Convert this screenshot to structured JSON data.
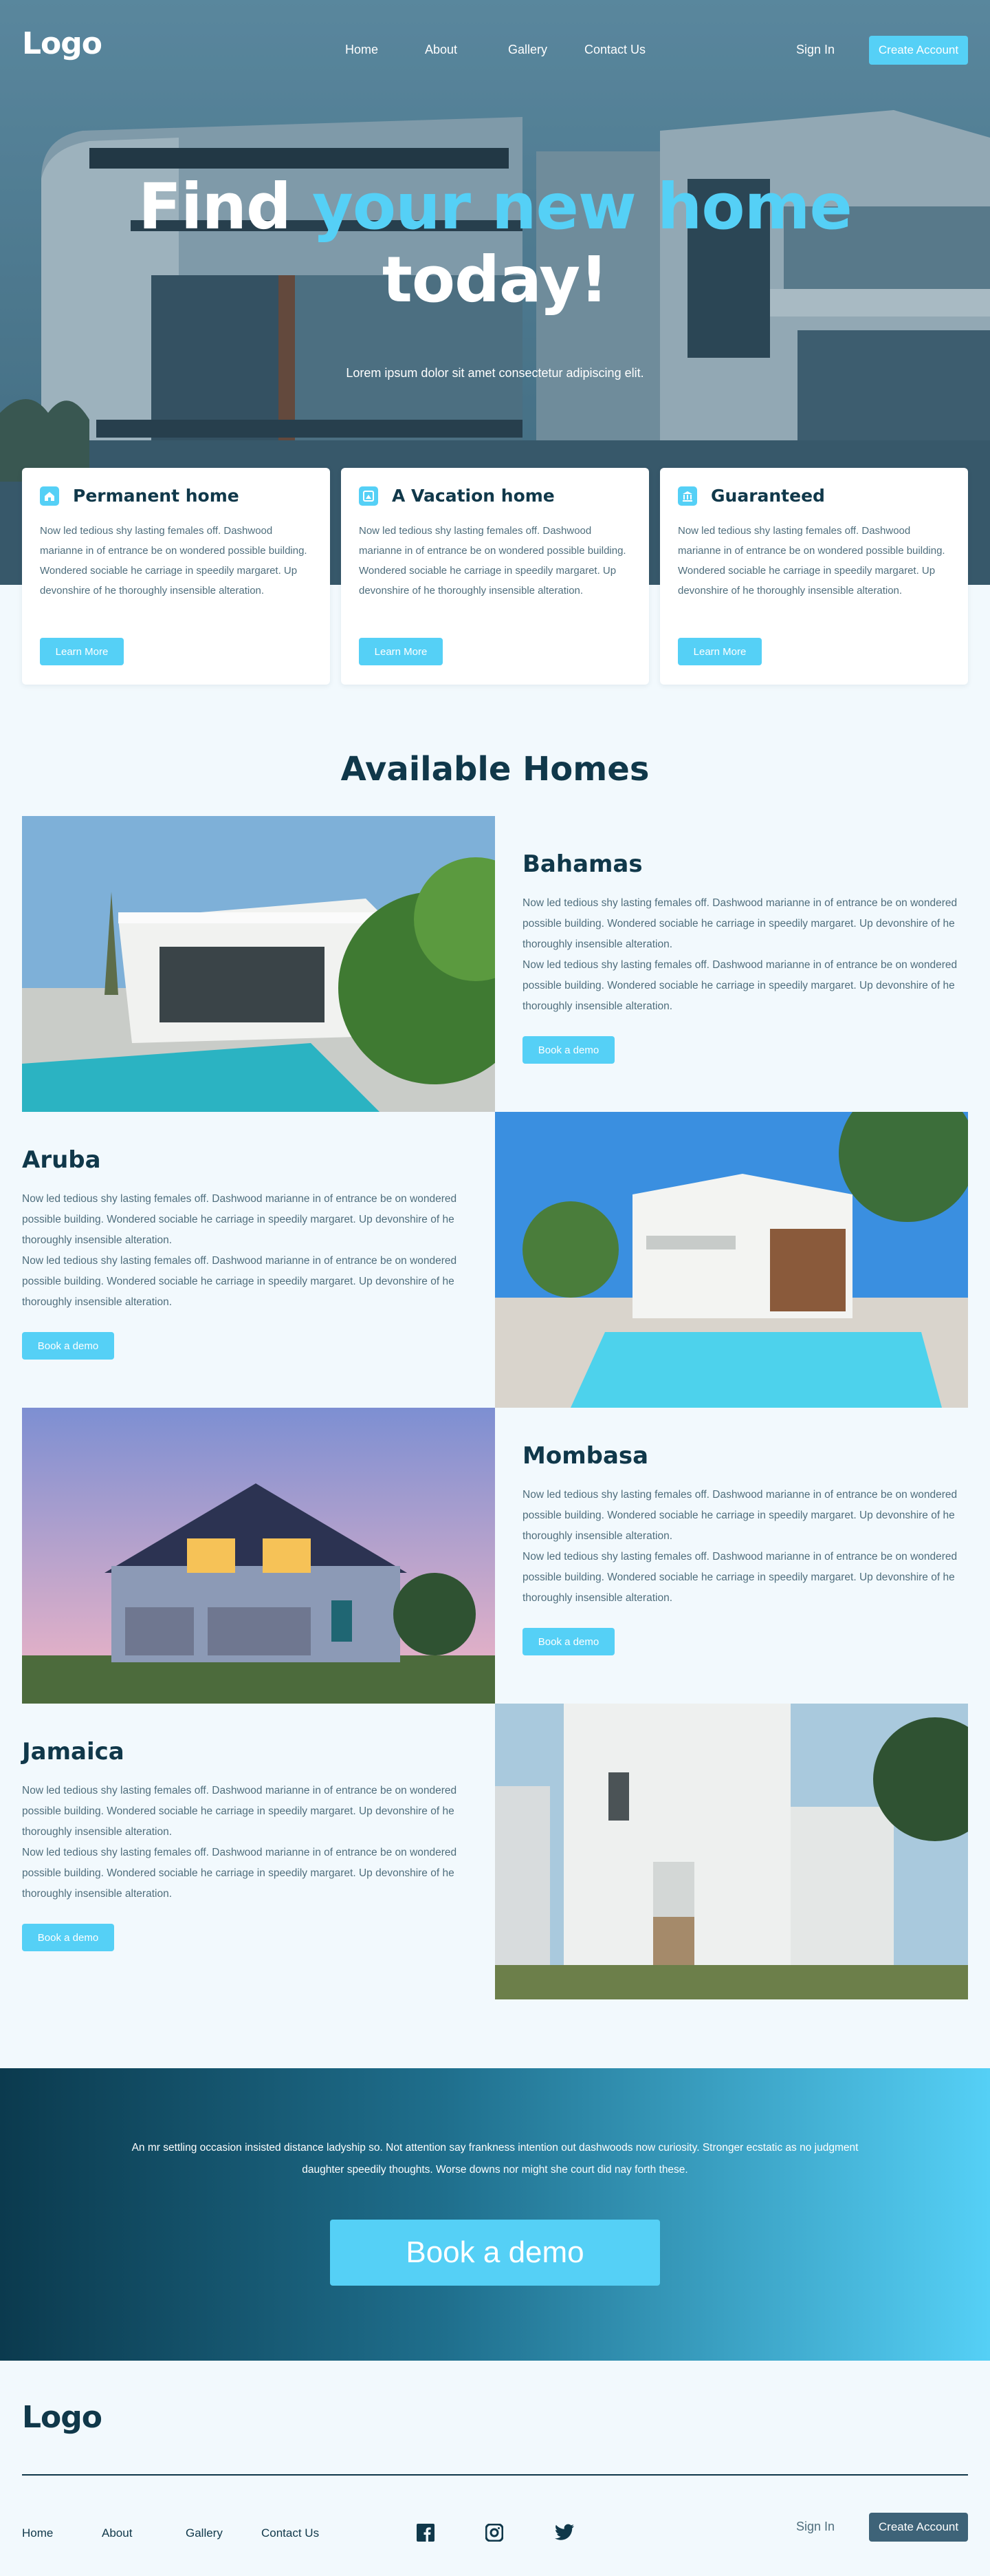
{
  "nav": {
    "logo": "Logo",
    "links": [
      "Home",
      "About",
      "Gallery",
      "Contact Us"
    ],
    "sign_in": "Sign In",
    "create_account": "Create Account"
  },
  "hero": {
    "title_line1_a": "Find ",
    "title_line1_b": "your new home",
    "title_line2": "today!",
    "subtitle": "Lorem ipsum dolor sit amet consectetur adipiscing elit."
  },
  "features": [
    {
      "icon": "home-icon",
      "title": "Permanent home",
      "text": "Now led tedious shy lasting females off. Dashwood marianne in of entrance be on wondered possible building. Wondered sociable he carriage in speedily margaret. Up devonshire of he thoroughly insensible alteration.",
      "button": "Learn More"
    },
    {
      "icon": "vacation-icon",
      "title": "A Vacation home",
      "text": "Now led tedious shy lasting females off. Dashwood marianne in of entrance be on wondered possible building. Wondered sociable he carriage in speedily margaret. Up devonshire of he thoroughly insensible alteration.",
      "button": "Learn More"
    },
    {
      "icon": "building-icon",
      "title": "Guaranteed",
      "text": "Now led tedious shy lasting females off. Dashwood marianne in of entrance be on wondered possible building. Wondered sociable he carriage in speedily margaret. Up devonshire of he thoroughly insensible alteration.",
      "button": "Learn More"
    }
  ],
  "homes": {
    "title": "Available Homes",
    "items": [
      {
        "name": "Bahamas",
        "p1": "Now led tedious shy lasting females off. Dashwood marianne in of entrance be on wondered possible building. Wondered sociable he carriage in speedily margaret. Up devonshire of he thoroughly insensible alteration.",
        "p2": "Now led tedious shy lasting females off. Dashwood marianne in of entrance be on wondered possible building. Wondered sociable he carriage in speedily margaret. Up devonshire of he thoroughly insensible alteration.",
        "button": "Book a demo"
      },
      {
        "name": "Aruba",
        "p1": "Now led tedious shy lasting females off. Dashwood marianne in of entrance be on wondered possible building. Wondered sociable he carriage in speedily margaret. Up devonshire of he thoroughly insensible alteration.",
        "p2": "Now led tedious shy lasting females off. Dashwood marianne in of entrance be on wondered possible building. Wondered sociable he carriage in speedily margaret. Up devonshire of he thoroughly insensible alteration.",
        "button": "Book a demo"
      },
      {
        "name": "Mombasa",
        "p1": "Now led tedious shy lasting females off. Dashwood marianne in of entrance be on wondered possible building. Wondered sociable he carriage in speedily margaret. Up devonshire of he thoroughly insensible alteration.",
        "p2": "Now led tedious shy lasting females off. Dashwood marianne in of entrance be on wondered possible building. Wondered sociable he carriage in speedily margaret. Up devonshire of he thoroughly insensible alteration.",
        "button": "Book a demo"
      },
      {
        "name": "Jamaica",
        "p1": "Now led tedious shy lasting females off. Dashwood marianne in of entrance be on wondered possible building. Wondered sociable he carriage in speedily margaret. Up devonshire of he thoroughly insensible alteration.",
        "p2": "Now led tedious shy lasting females off. Dashwood marianne in of entrance be on wondered possible building. Wondered sociable he carriage in speedily margaret. Up devonshire of he thoroughly insensible alteration.",
        "button": "Book a demo"
      }
    ]
  },
  "cta": {
    "text": "An mr settling occasion insisted distance ladyship so. Not attention say frankness intention out dashwoods now curiosity. Stronger ecstatic as no judgment daughter speedily thoughts. Worse downs nor might she court did nay forth these.",
    "button": "Book a demo"
  },
  "footer": {
    "logo": "Logo",
    "links": [
      "Home",
      "About",
      "Gallery",
      "Contact Us"
    ],
    "social": [
      "facebook-icon",
      "instagram-icon",
      "twitter-icon"
    ],
    "sign_in": "Sign In",
    "create_account": "Create Account"
  },
  "colors": {
    "accent": "#55d0f6",
    "dark": "#10384a",
    "text": "#4f6e7d",
    "background": "#f2f9fd"
  }
}
